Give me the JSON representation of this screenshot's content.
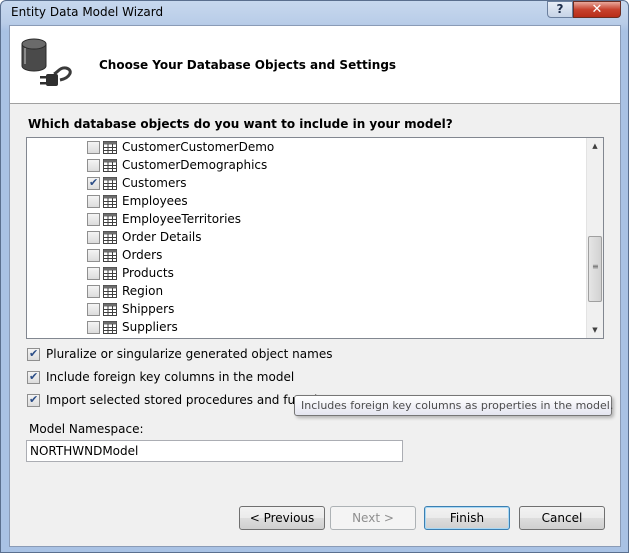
{
  "window": {
    "title": "Entity Data Model Wizard",
    "help_label": "?",
    "close_label": "✕"
  },
  "header": {
    "title": "Choose Your Database Objects and Settings"
  },
  "question": "Which database objects do you want to include in your model?",
  "tables": [
    {
      "name": "CustomerCustomerDemo",
      "checked": false
    },
    {
      "name": "CustomerDemographics",
      "checked": false
    },
    {
      "name": "Customers",
      "checked": true
    },
    {
      "name": "Employees",
      "checked": false
    },
    {
      "name": "EmployeeTerritories",
      "checked": false
    },
    {
      "name": "Order Details",
      "checked": false
    },
    {
      "name": "Orders",
      "checked": false
    },
    {
      "name": "Products",
      "checked": false
    },
    {
      "name": "Region",
      "checked": false
    },
    {
      "name": "Shippers",
      "checked": false
    },
    {
      "name": "Suppliers",
      "checked": false
    }
  ],
  "options": {
    "pluralize": {
      "label": "Pluralize or singularize generated object names",
      "checked": true
    },
    "foreign_keys": {
      "label": "Include foreign key columns in the model",
      "checked": true
    },
    "stored_procs": {
      "label": "Import selected stored procedures and functions",
      "checked": true
    }
  },
  "tooltip": "Includes foreign key columns as properties in the model.",
  "namespace": {
    "label": "Model Namespace:",
    "value": "NORTHWNDModel"
  },
  "buttons": {
    "previous": "< Previous",
    "next": "Next >",
    "finish": "Finish",
    "cancel": "Cancel"
  },
  "icons": {
    "database": "database-plug-icon",
    "table": "table-icon"
  },
  "colors": {
    "title_bar": "#b9cde8",
    "close_button": "#c7422e",
    "checkmark": "#2b4d87"
  }
}
